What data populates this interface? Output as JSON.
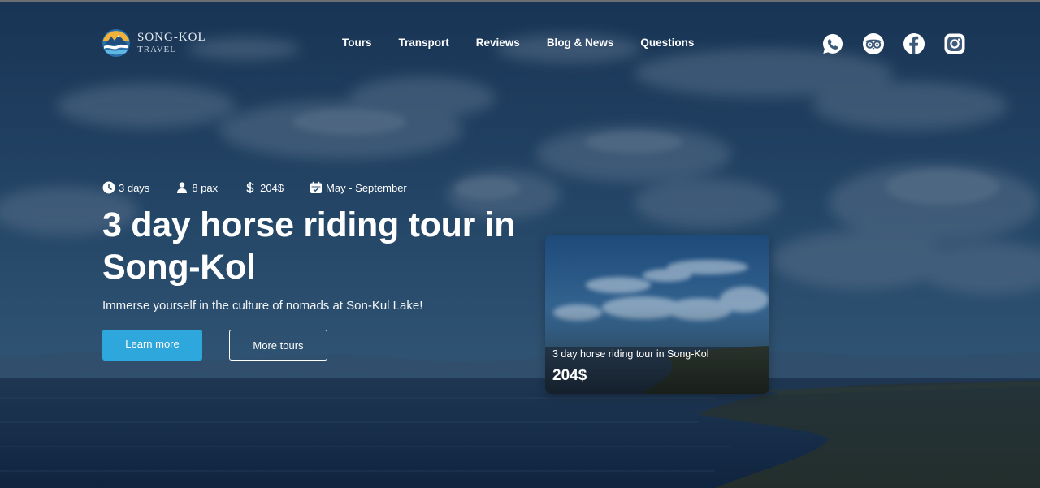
{
  "brand": {
    "name": "SONG-KOL",
    "subtitle": "TRAVEL"
  },
  "nav": {
    "items": [
      {
        "label": "Tours"
      },
      {
        "label": "Transport"
      },
      {
        "label": "Reviews"
      },
      {
        "label": "Blog & News"
      },
      {
        "label": "Questions"
      }
    ]
  },
  "socials": [
    "whatsapp-icon",
    "tripadvisor-icon",
    "facebook-icon",
    "instagram-icon"
  ],
  "hero": {
    "meta": {
      "duration": "3 days",
      "group": "8 pax",
      "price": "204$",
      "season": "May - September"
    },
    "title": "3 day horse riding tour in Song-Kol",
    "subtitle": "Immerse yourself in the culture of nomads at Son-Kul Lake!",
    "primary_cta": "Learn more",
    "secondary_cta": "More tours"
  },
  "card": {
    "title": "3 day horse riding tour in Song-Kol",
    "price": "204$"
  },
  "colors": {
    "accent": "#2ea7dd",
    "overlay": "#1c3a5c"
  }
}
